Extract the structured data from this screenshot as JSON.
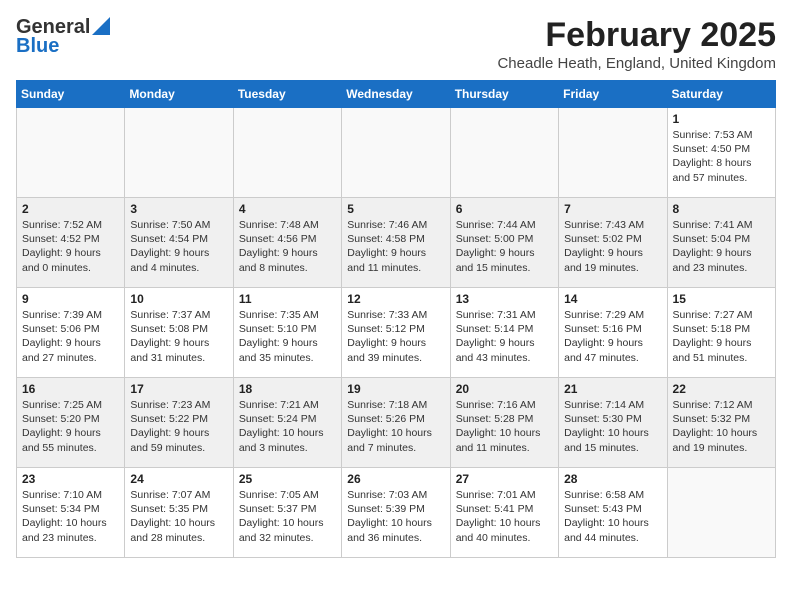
{
  "logo": {
    "general": "General",
    "blue": "Blue"
  },
  "title": "February 2025",
  "subtitle": "Cheadle Heath, England, United Kingdom",
  "days_of_week": [
    "Sunday",
    "Monday",
    "Tuesday",
    "Wednesday",
    "Thursday",
    "Friday",
    "Saturday"
  ],
  "weeks": [
    [
      {
        "day": "",
        "info": ""
      },
      {
        "day": "",
        "info": ""
      },
      {
        "day": "",
        "info": ""
      },
      {
        "day": "",
        "info": ""
      },
      {
        "day": "",
        "info": ""
      },
      {
        "day": "",
        "info": ""
      },
      {
        "day": "1",
        "info": "Sunrise: 7:53 AM\nSunset: 4:50 PM\nDaylight: 8 hours\nand 57 minutes."
      }
    ],
    [
      {
        "day": "2",
        "info": "Sunrise: 7:52 AM\nSunset: 4:52 PM\nDaylight: 9 hours\nand 0 minutes."
      },
      {
        "day": "3",
        "info": "Sunrise: 7:50 AM\nSunset: 4:54 PM\nDaylight: 9 hours\nand 4 minutes."
      },
      {
        "day": "4",
        "info": "Sunrise: 7:48 AM\nSunset: 4:56 PM\nDaylight: 9 hours\nand 8 minutes."
      },
      {
        "day": "5",
        "info": "Sunrise: 7:46 AM\nSunset: 4:58 PM\nDaylight: 9 hours\nand 11 minutes."
      },
      {
        "day": "6",
        "info": "Sunrise: 7:44 AM\nSunset: 5:00 PM\nDaylight: 9 hours\nand 15 minutes."
      },
      {
        "day": "7",
        "info": "Sunrise: 7:43 AM\nSunset: 5:02 PM\nDaylight: 9 hours\nand 19 minutes."
      },
      {
        "day": "8",
        "info": "Sunrise: 7:41 AM\nSunset: 5:04 PM\nDaylight: 9 hours\nand 23 minutes."
      }
    ],
    [
      {
        "day": "9",
        "info": "Sunrise: 7:39 AM\nSunset: 5:06 PM\nDaylight: 9 hours\nand 27 minutes."
      },
      {
        "day": "10",
        "info": "Sunrise: 7:37 AM\nSunset: 5:08 PM\nDaylight: 9 hours\nand 31 minutes."
      },
      {
        "day": "11",
        "info": "Sunrise: 7:35 AM\nSunset: 5:10 PM\nDaylight: 9 hours\nand 35 minutes."
      },
      {
        "day": "12",
        "info": "Sunrise: 7:33 AM\nSunset: 5:12 PM\nDaylight: 9 hours\nand 39 minutes."
      },
      {
        "day": "13",
        "info": "Sunrise: 7:31 AM\nSunset: 5:14 PM\nDaylight: 9 hours\nand 43 minutes."
      },
      {
        "day": "14",
        "info": "Sunrise: 7:29 AM\nSunset: 5:16 PM\nDaylight: 9 hours\nand 47 minutes."
      },
      {
        "day": "15",
        "info": "Sunrise: 7:27 AM\nSunset: 5:18 PM\nDaylight: 9 hours\nand 51 minutes."
      }
    ],
    [
      {
        "day": "16",
        "info": "Sunrise: 7:25 AM\nSunset: 5:20 PM\nDaylight: 9 hours\nand 55 minutes."
      },
      {
        "day": "17",
        "info": "Sunrise: 7:23 AM\nSunset: 5:22 PM\nDaylight: 9 hours\nand 59 minutes."
      },
      {
        "day": "18",
        "info": "Sunrise: 7:21 AM\nSunset: 5:24 PM\nDaylight: 10 hours\nand 3 minutes."
      },
      {
        "day": "19",
        "info": "Sunrise: 7:18 AM\nSunset: 5:26 PM\nDaylight: 10 hours\nand 7 minutes."
      },
      {
        "day": "20",
        "info": "Sunrise: 7:16 AM\nSunset: 5:28 PM\nDaylight: 10 hours\nand 11 minutes."
      },
      {
        "day": "21",
        "info": "Sunrise: 7:14 AM\nSunset: 5:30 PM\nDaylight: 10 hours\nand 15 minutes."
      },
      {
        "day": "22",
        "info": "Sunrise: 7:12 AM\nSunset: 5:32 PM\nDaylight: 10 hours\nand 19 minutes."
      }
    ],
    [
      {
        "day": "23",
        "info": "Sunrise: 7:10 AM\nSunset: 5:34 PM\nDaylight: 10 hours\nand 23 minutes."
      },
      {
        "day": "24",
        "info": "Sunrise: 7:07 AM\nSunset: 5:35 PM\nDaylight: 10 hours\nand 28 minutes."
      },
      {
        "day": "25",
        "info": "Sunrise: 7:05 AM\nSunset: 5:37 PM\nDaylight: 10 hours\nand 32 minutes."
      },
      {
        "day": "26",
        "info": "Sunrise: 7:03 AM\nSunset: 5:39 PM\nDaylight: 10 hours\nand 36 minutes."
      },
      {
        "day": "27",
        "info": "Sunrise: 7:01 AM\nSunset: 5:41 PM\nDaylight: 10 hours\nand 40 minutes."
      },
      {
        "day": "28",
        "info": "Sunrise: 6:58 AM\nSunset: 5:43 PM\nDaylight: 10 hours\nand 44 minutes."
      },
      {
        "day": "",
        "info": ""
      }
    ]
  ]
}
